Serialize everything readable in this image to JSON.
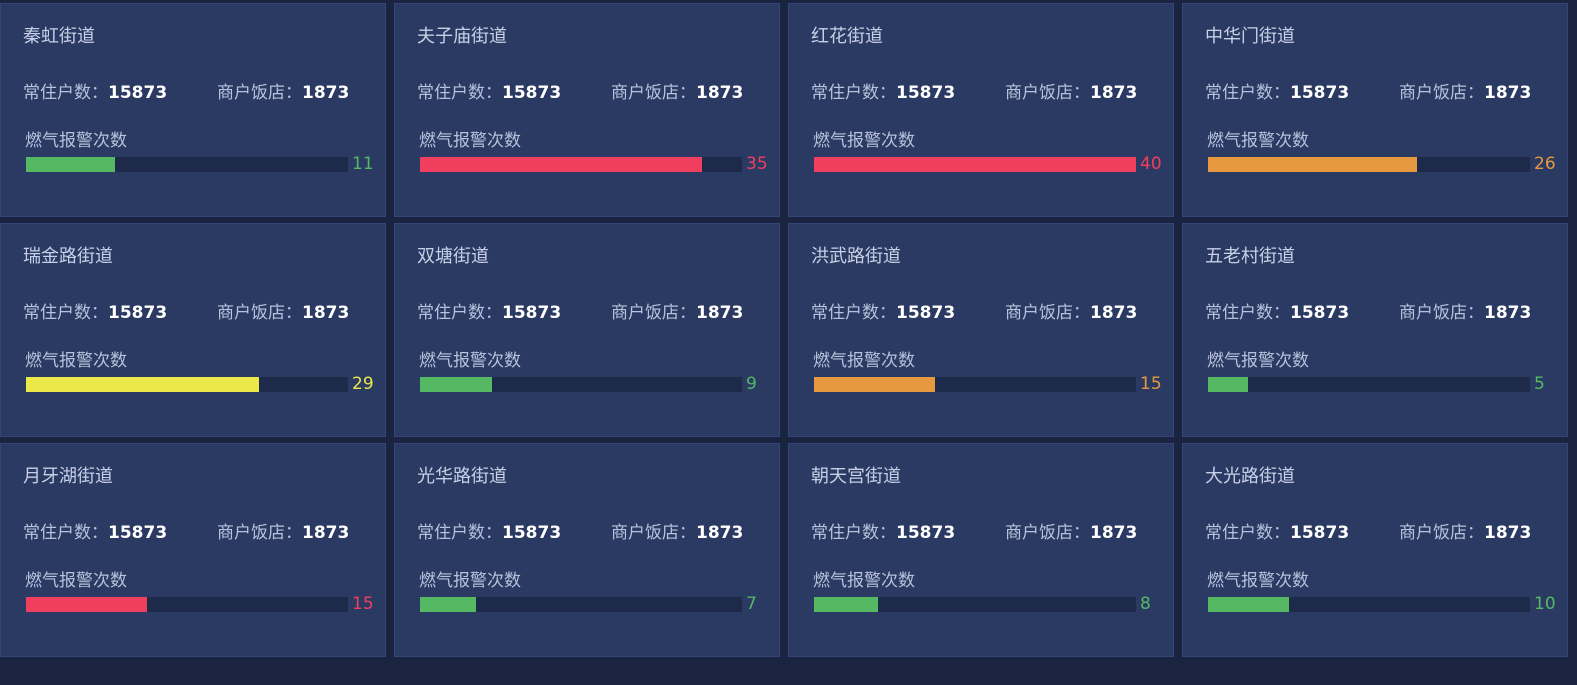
{
  "labels": {
    "residents": "常住户数：",
    "shops": "商户饭店：",
    "alarm": "燃气报警次数"
  },
  "max_alarm": 40,
  "colors": {
    "green": "#55b862",
    "red": "#f03e5f",
    "orange": "#e6993f",
    "yellow": "#ebe84a"
  },
  "streets": [
    {
      "name": "秦虹街道",
      "residents": "15873",
      "shops": "1873",
      "alarm": 11,
      "color": "green"
    },
    {
      "name": "夫子庙街道",
      "residents": "15873",
      "shops": "1873",
      "alarm": 35,
      "color": "red"
    },
    {
      "name": "红花街道",
      "residents": "15873",
      "shops": "1873",
      "alarm": 40,
      "color": "red"
    },
    {
      "name": "中华门街道",
      "residents": "15873",
      "shops": "1873",
      "alarm": 26,
      "color": "orange"
    },
    {
      "name": "瑞金路街道",
      "residents": "15873",
      "shops": "1873",
      "alarm": 29,
      "color": "yellow"
    },
    {
      "name": "双塘街道",
      "residents": "15873",
      "shops": "1873",
      "alarm": 9,
      "color": "green"
    },
    {
      "name": "洪武路街道",
      "residents": "15873",
      "shops": "1873",
      "alarm": 15,
      "color": "orange"
    },
    {
      "name": "五老村街道",
      "residents": "15873",
      "shops": "1873",
      "alarm": 5,
      "color": "green"
    },
    {
      "name": "月牙湖街道",
      "residents": "15873",
      "shops": "1873",
      "alarm": 15,
      "color": "red"
    },
    {
      "name": "光华路街道",
      "residents": "15873",
      "shops": "1873",
      "alarm": 7,
      "color": "green"
    },
    {
      "name": "朝天宫街道",
      "residents": "15873",
      "shops": "1873",
      "alarm": 8,
      "color": "green"
    },
    {
      "name": "大光路街道",
      "residents": "15873",
      "shops": "1873",
      "alarm": 10,
      "color": "green"
    }
  ]
}
